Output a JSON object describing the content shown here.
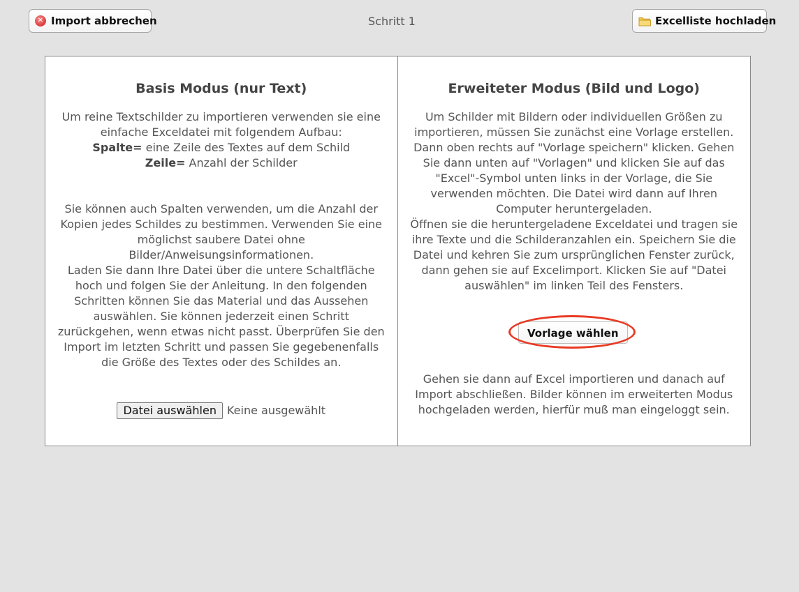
{
  "header": {
    "cancel_label": "Import abbrechen",
    "step_label": "Schritt 1",
    "upload_label": "Excelliste hochladen"
  },
  "basic_mode": {
    "title": "Basis Modus (nur Text)",
    "intro": "Um reine Textschilder zu importieren verwenden sie eine einfache Exceldatei mit folgendem Aufbau:",
    "column_term": "Spalte=",
    "column_desc": " eine Zeile des Textes auf dem Schild",
    "row_term": "Zeile=",
    "row_desc": " Anzahl der Schilder",
    "paragraph_copies": "Sie können auch Spalten verwenden, um die Anzahl der Kopien jedes Schildes zu bestimmen. Verwenden Sie eine möglichst saubere Datei ohne Bilder/Anweisungsinformationen.",
    "paragraph_instructions": "Laden Sie dann Ihre Datei über die untere Schaltfläche hoch und folgen Sie der Anleitung. In den folgenden Schritten können Sie das Material und das Aussehen auswählen. Sie können jederzeit einen Schritt zurückgehen, wenn etwas nicht passt. Überprüfen Sie den Import im letzten Schritt und passen Sie gegebenenfalls die Größe des Textes oder des Schildes an.",
    "file_button_label": "Datei auswählen",
    "file_status": "Keine ausgewählt"
  },
  "advanced_mode": {
    "title": "Erweiteter Modus (Bild und Logo)",
    "paragraph_template": "Um Schilder mit Bildern oder individuellen Größen zu importieren, müssen Sie zunächst eine Vorlage erstellen. Dann oben rechts auf \"Vorlage speichern\" klicken. Gehen Sie dann unten auf \"Vorlagen\" und klicken Sie auf das \"Excel\"-Symbol unten links in der Vorlage, die Sie verwenden möchten. Die Datei wird dann auf Ihren Computer heruntergeladen.",
    "paragraph_open": "Öffnen sie die heruntergeladene Exceldatei und tragen sie ihre Texte und die Schilderanzahlen ein. Speichern Sie die Datei und kehren Sie zum ursprünglichen Fenster zurück, dann gehen sie auf Excelimport. Klicken Sie auf \"Datei auswählen\" im linken Teil des Fensters.",
    "choose_template_label": "Vorlage wählen",
    "paragraph_finish": "Gehen sie dann auf Excel importieren und danach auf Import abschließen. Bilder können im erweiterten Modus hochgeladen werden, hierfür muß man eingeloggt sein."
  },
  "icons": {
    "cancel": "cancel-circle-icon",
    "upload": "folder-icon"
  },
  "colors": {
    "background": "#e3e3e3",
    "panel_background": "#ffffff",
    "highlight_ellipse": "#e83a23",
    "cancel_icon": "#e04545",
    "folder_icon": "#f2c94c"
  }
}
